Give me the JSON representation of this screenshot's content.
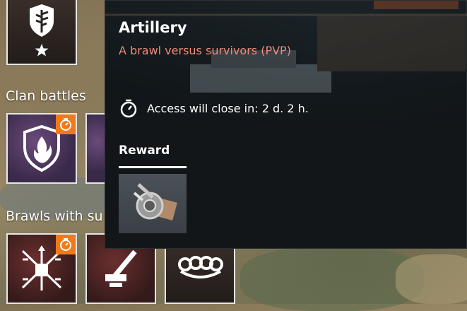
{
  "sections": {
    "clan_battles": "Clan battles",
    "brawls_with_survivors": "Brawls with su"
  },
  "tiles": {
    "top_icon": "shield-badge-icon",
    "clan_icon": "flame-shield-icon",
    "brawl_1_icon": "crosshair-drone-icon",
    "brawl_2_icon": "artillery-cannon-icon",
    "brawl_3_icon": "brass-knuckles-icon",
    "timer_badge_color": "#f07a1a"
  },
  "tooltip": {
    "title": "Artillery",
    "subtitle": "A brawl versus survivors (PVP)",
    "subtitle_color": "#f08a78",
    "access_icon": "stopwatch-icon",
    "access_text": "Access will close in: 2 d. 2 h.",
    "reward_label": "Reward",
    "reward_item_icon": "artillery-module-icon"
  }
}
